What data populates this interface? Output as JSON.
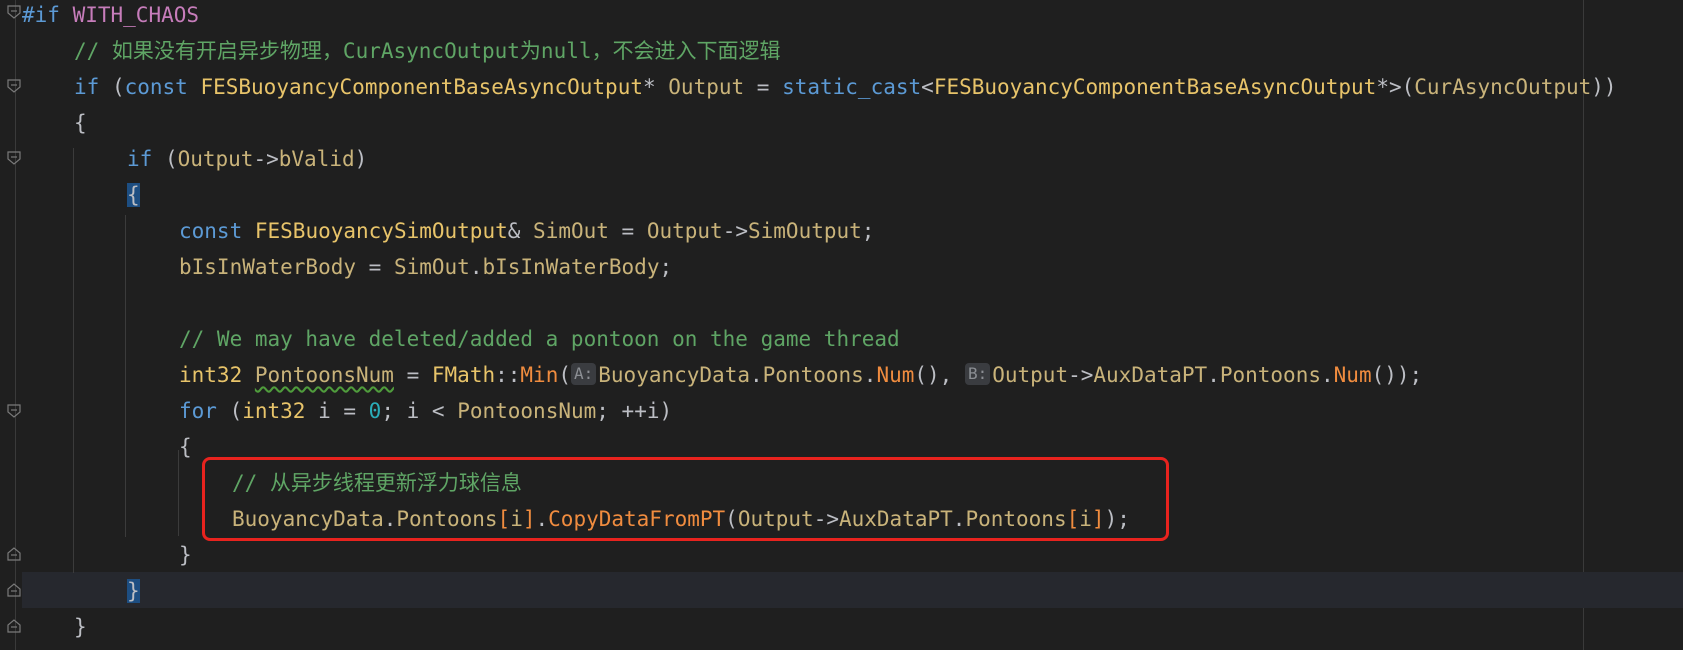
{
  "editor": {
    "lines": [
      {
        "directive": "#if",
        "macro": "WITH_CHAOS"
      },
      {
        "comment": "// 如果没有开启异步物理，CurAsyncOutput为null，不会进入下面逻辑"
      },
      {
        "kw_if": "if",
        "p1": " (",
        "kw_const": "const",
        "type1": "FESBuoyancyComponentBaseAsyncOutput",
        "p2": "* ",
        "var1": "Output",
        "p3": " = ",
        "fn_cast": "static_cast",
        "p4": "<",
        "type2": "FESBuoyancyComponentBaseAsyncOutput",
        "p5": "*>(",
        "var2": "CurAsyncOutput",
        "p6": "))"
      },
      {
        "text": "{"
      },
      {
        "kw_if": "if",
        "p1": " (",
        "var1": "Output",
        "p2": "->",
        "field": "bValid",
        "p3": ")"
      },
      {
        "brace": "{"
      },
      {
        "kw_const": "const",
        "type1": "FESBuoyancySimOutput",
        "p1": "& ",
        "var1": "SimOut",
        "p2": " = ",
        "var2": "Output",
        "p3": "->",
        "field": "SimOutput",
        "p4": ";"
      },
      {
        "var1": "bIsInWaterBody",
        "p1": " = ",
        "var2": "SimOut",
        "p2": ".",
        "field": "bIsInWaterBody",
        "p3": ";"
      },
      {
        "comment": "// We may have deleted/added a pontoon on the game thread"
      },
      {
        "type1": "int32",
        "p0": " ",
        "var1": "PontoonsNum",
        "p1": " = ",
        "type2": "FMath",
        "p2": "::",
        "fn": "Min",
        "p3": "(",
        "hintA": "A:",
        "var2": "BuoyancyData",
        "p4": ".",
        "field1": "Pontoons",
        "p5": ".",
        "fn2": "Num",
        "p6": "(), ",
        "hintB": "B:",
        "var3": "Output",
        "p7": "->",
        "field2": "AuxDataPT",
        "p8": ".",
        "field3": "Pontoons",
        "p9": ".",
        "fn3": "Num",
        "p10": "());"
      },
      {
        "kw_for": "for",
        "p1": " (",
        "type1": "int32",
        "p2": " i = ",
        "num": "0",
        "p3": "; i < ",
        "var1": "PontoonsNum",
        "p4": "; ++i)"
      },
      {
        "text": "{"
      },
      {
        "comment": "// 从异步线程更新浮力球信息"
      },
      {
        "var1": "BuoyancyData",
        "p1": ".",
        "field1": "Pontoons",
        "idx1": "[",
        "i1": "i",
        "idx2": "]",
        "p2": ".",
        "fn": "CopyDataFromPT",
        "p3": "(",
        "var2": "Output",
        "p4": "->",
        "field2": "AuxDataPT",
        "p5": ".",
        "field3": "Pontoons",
        "idx3": "[",
        "i2": "i",
        "idx4": "]",
        "p6": ");"
      },
      {
        "text": "}"
      },
      {
        "brace": "}"
      },
      {
        "text": "}"
      }
    ]
  },
  "colors": {
    "background": "#1f1f1f",
    "keyword": "#5c9ad5",
    "type": "#e8c46a",
    "function": "#f08c3f",
    "comment": "#5fa565",
    "highlight_box": "#e8231e"
  }
}
